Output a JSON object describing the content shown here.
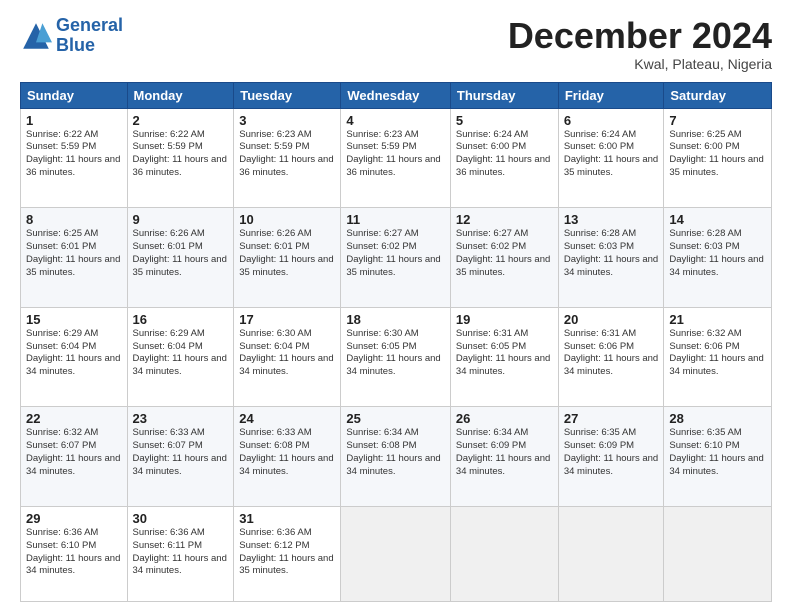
{
  "header": {
    "logo_line1": "General",
    "logo_line2": "Blue",
    "month": "December 2024",
    "location": "Kwal, Plateau, Nigeria"
  },
  "days_of_week": [
    "Sunday",
    "Monday",
    "Tuesday",
    "Wednesday",
    "Thursday",
    "Friday",
    "Saturday"
  ],
  "weeks": [
    [
      {
        "day": 1,
        "sunrise": "6:22 AM",
        "sunset": "5:59 PM",
        "daylight": "11 hours and 36 minutes."
      },
      {
        "day": 2,
        "sunrise": "6:22 AM",
        "sunset": "5:59 PM",
        "daylight": "11 hours and 36 minutes."
      },
      {
        "day": 3,
        "sunrise": "6:23 AM",
        "sunset": "5:59 PM",
        "daylight": "11 hours and 36 minutes."
      },
      {
        "day": 4,
        "sunrise": "6:23 AM",
        "sunset": "5:59 PM",
        "daylight": "11 hours and 36 minutes."
      },
      {
        "day": 5,
        "sunrise": "6:24 AM",
        "sunset": "6:00 PM",
        "daylight": "11 hours and 36 minutes."
      },
      {
        "day": 6,
        "sunrise": "6:24 AM",
        "sunset": "6:00 PM",
        "daylight": "11 hours and 35 minutes."
      },
      {
        "day": 7,
        "sunrise": "6:25 AM",
        "sunset": "6:00 PM",
        "daylight": "11 hours and 35 minutes."
      }
    ],
    [
      {
        "day": 8,
        "sunrise": "6:25 AM",
        "sunset": "6:01 PM",
        "daylight": "11 hours and 35 minutes."
      },
      {
        "day": 9,
        "sunrise": "6:26 AM",
        "sunset": "6:01 PM",
        "daylight": "11 hours and 35 minutes."
      },
      {
        "day": 10,
        "sunrise": "6:26 AM",
        "sunset": "6:01 PM",
        "daylight": "11 hours and 35 minutes."
      },
      {
        "day": 11,
        "sunrise": "6:27 AM",
        "sunset": "6:02 PM",
        "daylight": "11 hours and 35 minutes."
      },
      {
        "day": 12,
        "sunrise": "6:27 AM",
        "sunset": "6:02 PM",
        "daylight": "11 hours and 35 minutes."
      },
      {
        "day": 13,
        "sunrise": "6:28 AM",
        "sunset": "6:03 PM",
        "daylight": "11 hours and 34 minutes."
      },
      {
        "day": 14,
        "sunrise": "6:28 AM",
        "sunset": "6:03 PM",
        "daylight": "11 hours and 34 minutes."
      }
    ],
    [
      {
        "day": 15,
        "sunrise": "6:29 AM",
        "sunset": "6:04 PM",
        "daylight": "11 hours and 34 minutes."
      },
      {
        "day": 16,
        "sunrise": "6:29 AM",
        "sunset": "6:04 PM",
        "daylight": "11 hours and 34 minutes."
      },
      {
        "day": 17,
        "sunrise": "6:30 AM",
        "sunset": "6:04 PM",
        "daylight": "11 hours and 34 minutes."
      },
      {
        "day": 18,
        "sunrise": "6:30 AM",
        "sunset": "6:05 PM",
        "daylight": "11 hours and 34 minutes."
      },
      {
        "day": 19,
        "sunrise": "6:31 AM",
        "sunset": "6:05 PM",
        "daylight": "11 hours and 34 minutes."
      },
      {
        "day": 20,
        "sunrise": "6:31 AM",
        "sunset": "6:06 PM",
        "daylight": "11 hours and 34 minutes."
      },
      {
        "day": 21,
        "sunrise": "6:32 AM",
        "sunset": "6:06 PM",
        "daylight": "11 hours and 34 minutes."
      }
    ],
    [
      {
        "day": 22,
        "sunrise": "6:32 AM",
        "sunset": "6:07 PM",
        "daylight": "11 hours and 34 minutes."
      },
      {
        "day": 23,
        "sunrise": "6:33 AM",
        "sunset": "6:07 PM",
        "daylight": "11 hours and 34 minutes."
      },
      {
        "day": 24,
        "sunrise": "6:33 AM",
        "sunset": "6:08 PM",
        "daylight": "11 hours and 34 minutes."
      },
      {
        "day": 25,
        "sunrise": "6:34 AM",
        "sunset": "6:08 PM",
        "daylight": "11 hours and 34 minutes."
      },
      {
        "day": 26,
        "sunrise": "6:34 AM",
        "sunset": "6:09 PM",
        "daylight": "11 hours and 34 minutes."
      },
      {
        "day": 27,
        "sunrise": "6:35 AM",
        "sunset": "6:09 PM",
        "daylight": "11 hours and 34 minutes."
      },
      {
        "day": 28,
        "sunrise": "6:35 AM",
        "sunset": "6:10 PM",
        "daylight": "11 hours and 34 minutes."
      }
    ],
    [
      {
        "day": 29,
        "sunrise": "6:36 AM",
        "sunset": "6:10 PM",
        "daylight": "11 hours and 34 minutes."
      },
      {
        "day": 30,
        "sunrise": "6:36 AM",
        "sunset": "6:11 PM",
        "daylight": "11 hours and 34 minutes."
      },
      {
        "day": 31,
        "sunrise": "6:36 AM",
        "sunset": "6:12 PM",
        "daylight": "11 hours and 35 minutes."
      },
      null,
      null,
      null,
      null
    ]
  ]
}
